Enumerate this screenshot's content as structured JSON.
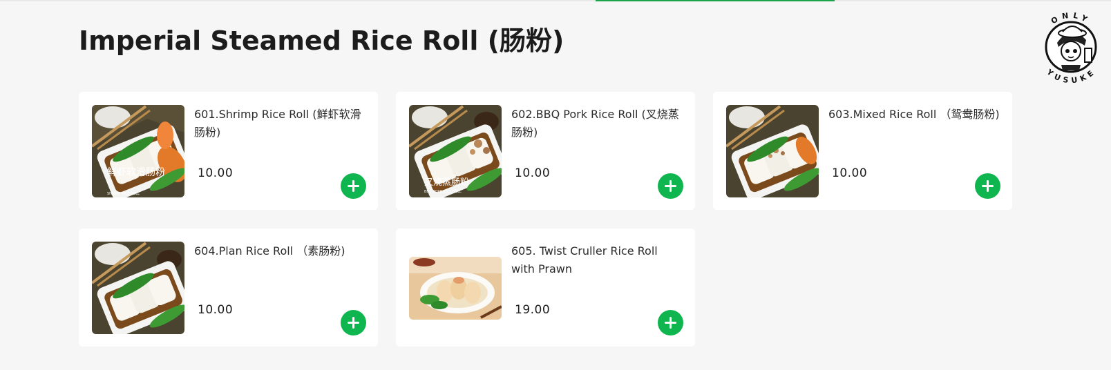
{
  "category": {
    "title": "Imperial Steamed Rice Roll (肠粉)"
  },
  "brand": {
    "logo_text_top": "ONLY",
    "logo_text_bottom": "YUSUKE"
  },
  "colors": {
    "accent_green": "#0fb54e",
    "active_tab_underline": "#1aa34a"
  },
  "items": [
    {
      "name": "601.Shrimp Rice Roll (鲜虾软滑肠粉)",
      "price": "10.00",
      "image_caption": "鲜虾软滑肠粉",
      "image_subcaption": "SHRIMP RICE ROLL",
      "add_icon": "plus-icon"
    },
    {
      "name": "602.BBQ Pork Rice Roll (叉烧蒸肠粉)",
      "price": "10.00",
      "image_caption": "叉烧蒸肠粉",
      "image_subcaption": "BBQ PORK RICE ROLL",
      "add_icon": "plus-icon"
    },
    {
      "name": "603.Mixed Rice Roll （鸳鸯肠粉)",
      "price": "10.00",
      "add_icon": "plus-icon"
    },
    {
      "name": "604.Plan Rice Roll （素肠粉)",
      "price": "10.00",
      "add_icon": "plus-icon"
    },
    {
      "name": "605. Twist Cruller Rice Roll with Prawn",
      "price": "19.00",
      "add_icon": "plus-icon"
    }
  ]
}
